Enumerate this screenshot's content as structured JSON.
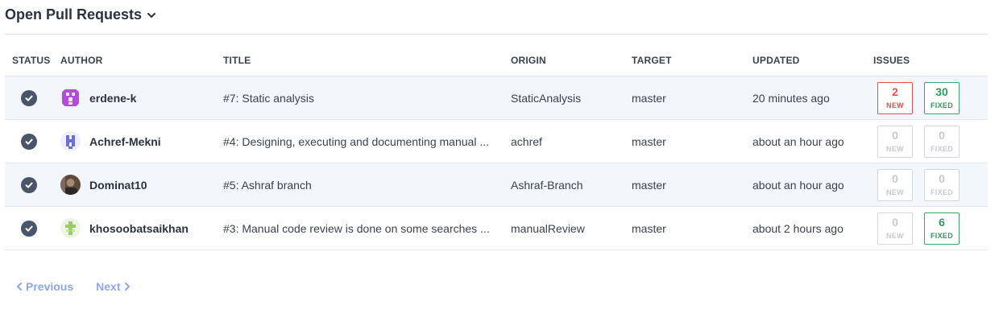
{
  "header": {
    "title": "Open Pull Requests",
    "chevron_icon": "chevron-down-icon"
  },
  "table": {
    "columns": [
      "STATUS",
      "AUTHOR",
      "TITLE",
      "ORIGIN",
      "TARGET",
      "UPDATED",
      "ISSUES"
    ],
    "rows": [
      {
        "status_icon": "check-circle-icon",
        "author": "erdene-k",
        "title": "#7: Static analysis",
        "origin": "StaticAnalysis",
        "target": "master",
        "updated": "20 minutes ago",
        "new_count": "2",
        "new_label": "NEW",
        "fixed_count": "30",
        "fixed_label": "FIXED"
      },
      {
        "status_icon": "check-circle-icon",
        "author": "Achref-Mekni",
        "title": "#4: Designing, executing and documenting manual ...",
        "origin": "achref",
        "target": "master",
        "updated": "about an hour ago",
        "new_count": "0",
        "new_label": "NEW",
        "fixed_count": "0",
        "fixed_label": "FIXED"
      },
      {
        "status_icon": "check-circle-icon",
        "author": "Dominat10",
        "title": "#5: Ashraf branch",
        "origin": "Ashraf-Branch",
        "target": "master",
        "updated": "about an hour ago",
        "new_count": "0",
        "new_label": "NEW",
        "fixed_count": "0",
        "fixed_label": "FIXED"
      },
      {
        "status_icon": "check-circle-icon",
        "author": "khosoobatsaikhan",
        "title": "#3: Manual code review is done on some searches ...",
        "origin": "manualReview",
        "target": "master",
        "updated": "about 2 hours ago",
        "new_count": "0",
        "new_label": "NEW",
        "fixed_count": "6",
        "fixed_label": "FIXED"
      }
    ]
  },
  "pagination": {
    "previous_label": "Previous",
    "next_label": "Next"
  },
  "colors": {
    "new_active": "#e05252",
    "fixed_active": "#2f9a5e",
    "zero_badge": "#c5cad0",
    "link": "#8fa6e8",
    "row_alt": "#f3f6fb"
  }
}
